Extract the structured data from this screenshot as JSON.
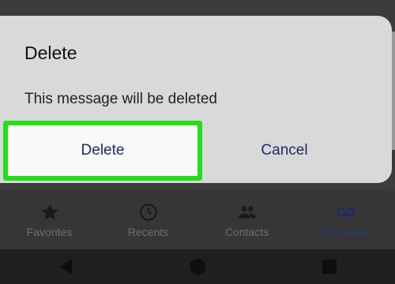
{
  "dialog": {
    "title": "Delete",
    "message": "This message will be deleted",
    "delete_label": "Delete",
    "cancel_label": "Cancel"
  },
  "bottom_nav": {
    "items": [
      {
        "label": "Favorites",
        "icon": "star-icon"
      },
      {
        "label": "Recents",
        "icon": "clock-icon"
      },
      {
        "label": "Contacts",
        "icon": "people-icon"
      },
      {
        "label": "Voicemail",
        "icon": "voicemail-icon"
      }
    ],
    "active": "Voicemail"
  },
  "system_bar": {
    "buttons": [
      "back-icon",
      "home-icon",
      "recents-icon"
    ]
  },
  "colors": {
    "highlight": "#21e018",
    "dialog_bg": "#d9d9d9",
    "button_text": "#1c2b64"
  }
}
